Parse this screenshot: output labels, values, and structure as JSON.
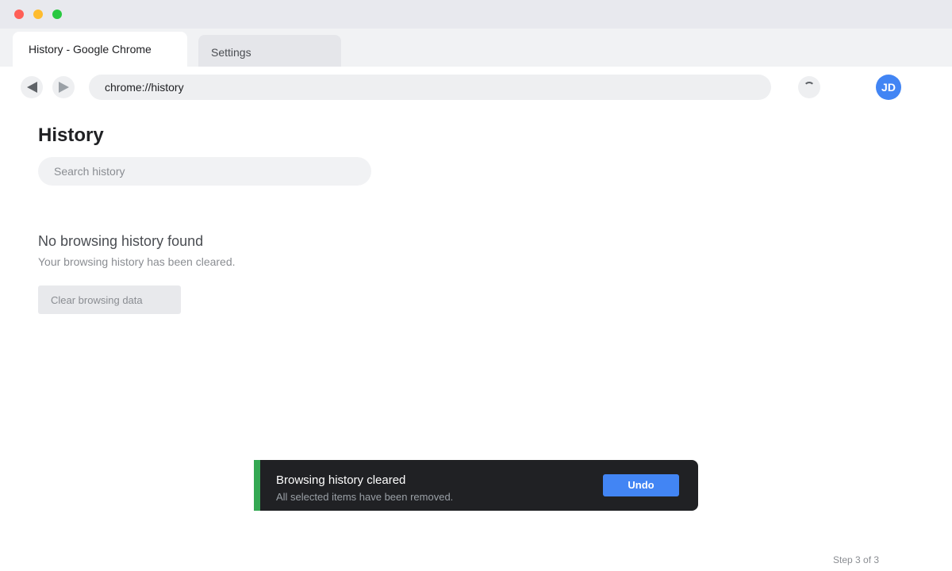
{
  "window": {
    "tabs": [
      {
        "label": "History - Google Chrome",
        "active": true
      },
      {
        "label": "Settings",
        "active": false
      }
    ]
  },
  "toolbar": {
    "back_icon": "back-arrow-icon",
    "forward_icon": "forward-arrow-icon",
    "address": "chrome://history",
    "loading_icon": "loading-spinner-icon",
    "avatar_initials": "JD",
    "avatar_color": "#4285f4"
  },
  "main": {
    "title": "History",
    "search_placeholder": "Search history",
    "empty_title": "No browsing history found",
    "empty_subtitle": "Your browsing history has been cleared.",
    "clear_button": "Clear browsing data"
  },
  "toast": {
    "title": "Browsing history cleared",
    "subtitle": "All selected items have been removed.",
    "action": "Undo",
    "accent_color": "#34a853",
    "background": "#202124"
  },
  "footer": {
    "step": "Step 3 of 3"
  }
}
